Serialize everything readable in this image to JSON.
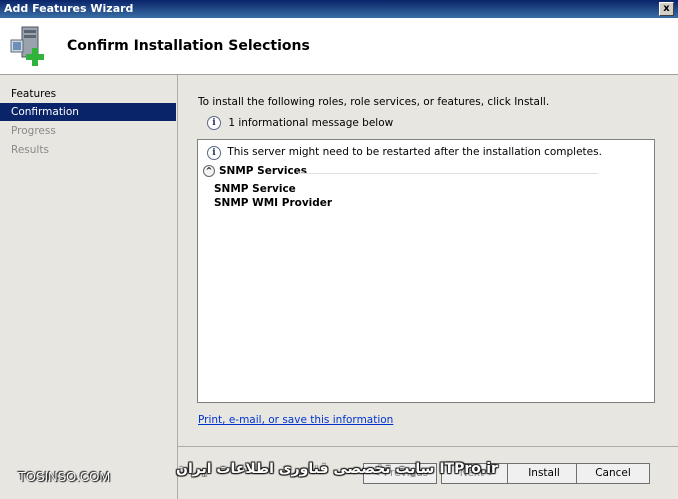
{
  "window": {
    "title": "Add Features Wizard",
    "close_glyph": "x"
  },
  "header": {
    "heading": "Confirm Installation Selections",
    "logo_icon": "server-add-icon"
  },
  "sidebar": {
    "steps": [
      {
        "label": "Features",
        "state": "normal"
      },
      {
        "label": "Confirmation",
        "state": "active"
      },
      {
        "label": "Progress",
        "state": "muted"
      },
      {
        "label": "Results",
        "state": "muted"
      }
    ]
  },
  "main": {
    "instruction": "To install the following roles, role services, or features, click Install.",
    "info_count_message": "1 informational message below",
    "info_icon": "info-icon",
    "panel": {
      "note": "This server might need to be restarted after the installation completes.",
      "section_title": "SNMP Services",
      "items": [
        "SNMP Service",
        "SNMP WMI Provider"
      ]
    },
    "link": "Print, e-mail, or save this information"
  },
  "buttons": {
    "previous": "< Previous",
    "next": "Next >",
    "install": "Install",
    "cancel": "Cancel"
  },
  "watermark": {
    "left": "TOSINSO.COM",
    "right": "سایت تخصصی فناوری اطلاعات ایران ITPro.ir"
  }
}
